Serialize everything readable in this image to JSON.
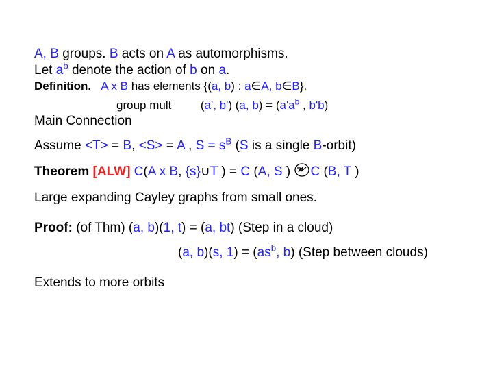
{
  "line1_a": "A, B ",
  "line1_b": "groups.  ",
  "line1_c": "B ",
  "line1_d": "acts on ",
  "line1_e": "A ",
  "line1_f": "as automorphisms.",
  "line2_a": "Let ",
  "line2_b": "a",
  "line2_c": "b",
  "line2_d": " denote the action of ",
  "line2_e": "b ",
  "line2_f": "on ",
  "line2_g": "a",
  "line2_h": ".",
  "line3_a": "Definition.",
  "line3_b": "A x B",
  "line3_c": "  has elements {(",
  "line3_d": "a, b",
  "line3_e": ") : ",
  "line3_f": "a",
  "line3_g": "∈",
  "line3_h": "A, b",
  "line3_i": "∈",
  "line3_j": "B",
  "line3_k": "}.",
  "line4_a": "group mult",
  "line4_b": "(",
  "line4_c": "a', b'",
  "line4_d": ") (",
  "line4_e": "a, b",
  "line4_f": ") = (",
  "line4_g": "a'a",
  "line4_h": "b",
  "line4_i": " , ",
  "line4_j": "b'b",
  "line4_k": ")",
  "line5": "Main Connection",
  "line6_a": "Assume ",
  "line6_b": "<T>",
  "line6_c": " = ",
  "line6_d": "B",
  "line6_e": ",  ",
  "line6_f": "<S>",
  "line6_g": " = ",
  "line6_h": "A ",
  "line6_i": ",  ",
  "line6_j": "S = s",
  "line6_k": "B",
  "line6_l": "  (",
  "line6_m": "S",
  "line6_n": " is a single ",
  "line6_o": "B",
  "line6_p": "-orbit)",
  "line7_a": "Theorem",
  "line7_b": " [ALW]",
  "line7_c": " C",
  "line7_d": "(",
  "line7_e": "A x B",
  "line7_f": ", ",
  "line7_g": "{s}",
  "line7_h": "∪",
  "line7_i": "T ",
  "line7_j": ") = ",
  "line7_k": "C ",
  "line7_l": "(",
  "line7_m": "A, S ",
  "line7_n": ")  ",
  "line7_o": "ⓩ",
  "line7_p": "C ",
  "line7_q": "(",
  "line7_r": "B, T ",
  "line7_s": ")",
  "line8": "Large expanding Cayley graphs from small ones.",
  "line9_a": "Proof:",
  "line9_b": " (of Thm)   (",
  "line9_c": "a, b",
  "line9_d": ")(",
  "line9_e": "1, t",
  "line9_f": ") = (",
  "line9_g": "a, bt",
  "line9_h": ")    (Step in a cloud)",
  "line10_a": "(",
  "line10_b": "a, b",
  "line10_c": ")(",
  "line10_d": "s, 1",
  "line10_e": ") = (",
  "line10_f": "as",
  "line10_g": "b",
  "line10_h": ", b",
  "line10_i": ")   (Step between clouds)",
  "line11": "Extends to more orbits"
}
